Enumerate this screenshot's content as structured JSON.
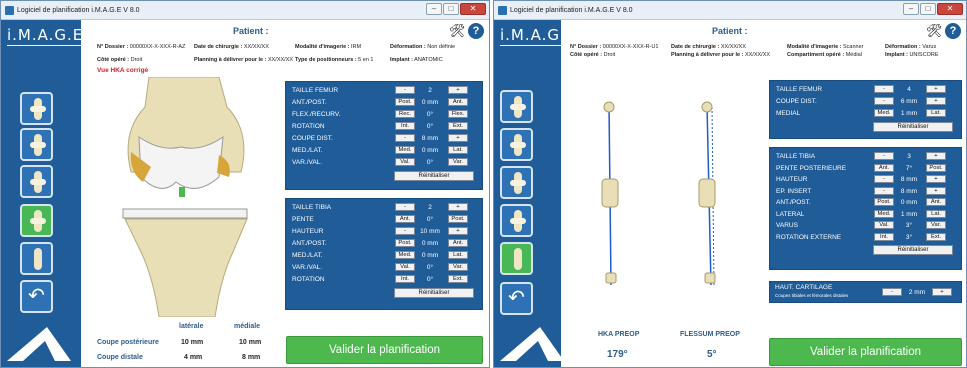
{
  "w1": {
    "title": "Logiciel de planification i.M.A.G.E V 8.0",
    "logo": "i.M.A.G.E.",
    "patient_label": "Patient :",
    "info": [
      {
        "k": "N° Dossier :",
        "v": "00000XX-X-XXX-R-AZ"
      },
      {
        "k": "Date de chirurgie :",
        "v": "XX/XX/XX"
      },
      {
        "k": "Modalité d'imagerie :",
        "v": "IRM"
      },
      {
        "k": "Déformation :",
        "v": "Non définie"
      },
      {
        "k": "Côté opéré :",
        "v": "Droit"
      },
      {
        "k": "Planning à délivrer pour le :",
        "v": "XX/XX/XX"
      },
      {
        "k": "Type de positionneurs :",
        "v": "5 en 1"
      },
      {
        "k": "Implant :",
        "v": "ANATOMIC"
      }
    ],
    "hka_note": "Vue HKA corrigé",
    "femur": {
      "rows": [
        {
          "label": "TAILLE FEMUR",
          "b1": "-",
          "val": "2",
          "b2": "+"
        },
        {
          "label": "ANT./POST.",
          "b1": "Post.",
          "val": "0 mm",
          "b2": "Ant."
        },
        {
          "label": "FLEX./RECURV.",
          "b1": "Rec.",
          "val": "0°",
          "b2": "Flex."
        },
        {
          "label": "ROTATION",
          "b1": "Int.",
          "val": "0°",
          "b2": "Ext."
        },
        {
          "label": "COUPE DIST.",
          "b1": "-",
          "val": "8 mm",
          "b2": "+"
        },
        {
          "label": "MED./LAT.",
          "b1": "Med.",
          "val": "0 mm",
          "b2": "Lat."
        },
        {
          "label": "VAR./VAL.",
          "b1": "Val.",
          "val": "0°",
          "b2": "Var."
        }
      ],
      "reset": "Réinitialiser"
    },
    "tibia": {
      "rows": [
        {
          "label": "TAILLE TIBIA",
          "b1": "-",
          "val": "2",
          "b2": "+"
        },
        {
          "label": "PENTE",
          "b1": "Ant.",
          "val": "0°",
          "b2": "Post."
        },
        {
          "label": "HAUTEUR",
          "b1": "-",
          "val": "10 mm",
          "b2": "+"
        },
        {
          "label": "ANT./POST.",
          "b1": "Post.",
          "val": "0 mm",
          "b2": "Ant."
        },
        {
          "label": "MED./LAT.",
          "b1": "Med.",
          "val": "0 mm",
          "b2": "Lat."
        },
        {
          "label": "VAR./VAL.",
          "b1": "Val.",
          "val": "0°",
          "b2": "Var."
        },
        {
          "label": "ROTATION",
          "b1": "Int.",
          "val": "0°",
          "b2": "Ext."
        }
      ],
      "reset": "Réinitialiser"
    },
    "cuts": {
      "col1": "latérale",
      "col2": "médiale",
      "rows": [
        {
          "label": "Coupe postérieure",
          "lat": "10 mm",
          "med": "10 mm"
        },
        {
          "label": "Coupe distale",
          "lat": "4 mm",
          "med": "8 mm"
        }
      ]
    },
    "validate": "Valider la planification"
  },
  "w2": {
    "title": "Logiciel de planification i.M.A.G.E V 8.0",
    "logo": "i.M.A.G.E.",
    "patient_label": "Patient :",
    "info": [
      {
        "k": "N° Dossier :",
        "v": "00000XX-X-XXX-R-U1"
      },
      {
        "k": "Date de chirurgie :",
        "v": "XX/XX/XX"
      },
      {
        "k": "Modalité d'imagerie :",
        "v": "Scanner"
      },
      {
        "k": "Déformation :",
        "v": "Varus"
      },
      {
        "k": "Côté opéré :",
        "v": "Droit"
      },
      {
        "k": "Planning à délivrer pour le :",
        "v": "XX/XX/XX"
      },
      {
        "k": "Compartiment opéré :",
        "v": "Médial"
      },
      {
        "k": "Implant :",
        "v": "UNISCORE"
      }
    ],
    "femur": {
      "rows": [
        {
          "label": "TAILLE FEMUR",
          "b1": "-",
          "val": "4",
          "b2": "+"
        },
        {
          "label": "COUPE DIST.",
          "b1": "-",
          "val": "6 mm",
          "b2": "+"
        },
        {
          "label": "MEDIAL",
          "b1": "Med.",
          "val": "1 mm",
          "b2": "Lat."
        }
      ],
      "reset": "Réinitialiser"
    },
    "tibia": {
      "rows": [
        {
          "label": "TAILLE TIBIA",
          "b1": "-",
          "val": "3",
          "b2": "+"
        },
        {
          "label": "PENTE POSTERIEURE",
          "b1": "Ant.",
          "val": "7°",
          "b2": "Post."
        },
        {
          "label": "HAUTEUR",
          "b1": "-",
          "val": "8 mm",
          "b2": "+"
        },
        {
          "label": "EP. INSERT",
          "b1": "-",
          "val": "8 mm",
          "b2": "+"
        },
        {
          "label": "ANT./POST.",
          "b1": "Post.",
          "val": "0 mm",
          "b2": "Ant."
        },
        {
          "label": "LATERAL",
          "b1": "Med.",
          "val": "1 mm",
          "b2": "Lat."
        },
        {
          "label": "VARUS",
          "b1": "Val.",
          "val": "3°",
          "b2": "Var."
        },
        {
          "label": "ROTATION EXTERNE",
          "b1": "Int.",
          "val": "3°",
          "b2": "Ext."
        }
      ],
      "reset": "Réinitialiser"
    },
    "cartilage": {
      "label": "HAUT. CARTILAGE",
      "sub": "Coupes tibiales et fémorales distales",
      "b1": "-",
      "val": "2 mm",
      "b2": "+"
    },
    "hka": {
      "label": "HKA PREOP",
      "value": "179°"
    },
    "flessum": {
      "label": "FLESSUM PREOP",
      "value": "5°"
    },
    "validate": "Valider la planification"
  }
}
